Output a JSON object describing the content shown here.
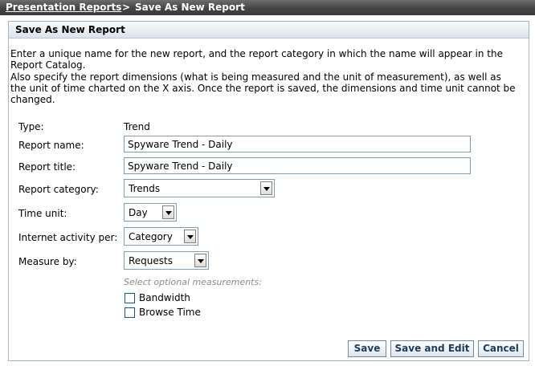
{
  "breadcrumb": {
    "link": "Presentation Reports",
    "separator": ">",
    "current": "Save As New Report"
  },
  "panel": {
    "title": "Save As New Report",
    "description1": "Enter a unique name for the new report, and the report category in which the name will appear in the Report Catalog.",
    "description2": "Also specify the report dimensions (what is being measured and the unit of measurement), as well as the unit of time charted on the X axis. Once the report is saved, the dimensions and time unit cannot be changed."
  },
  "form": {
    "type_label": "Type:",
    "type_value": "Trend",
    "name_label": "Report name:",
    "name_value": "Spyware Trend - Daily",
    "title_label": "Report title:",
    "title_value": "Spyware Trend - Daily",
    "category_label": "Report category:",
    "category_value": "Trends",
    "time_unit_label": "Time unit:",
    "time_unit_value": "Day",
    "activity_label": "Internet activity per:",
    "activity_value": "Category",
    "measure_label": "Measure by:",
    "measure_value": "Requests",
    "optional_hint": "Select optional measurements:",
    "bandwidth_label": "Bandwidth",
    "bandwidth_checked": false,
    "browse_time_label": "Browse Time",
    "browse_time_checked": false
  },
  "buttons": {
    "save": "Save",
    "save_edit": "Save and Edit",
    "cancel": "Cancel"
  }
}
